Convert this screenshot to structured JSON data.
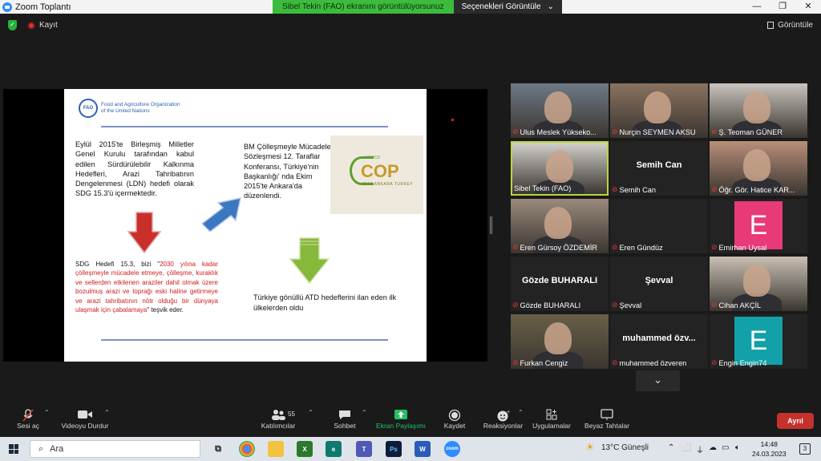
{
  "window": {
    "title": "Zoom Toplantı"
  },
  "share_bar": {
    "status": "Sibel Tekin (FAO) ekranını görüntülüyorsunuz",
    "options": "Seçenekleri Görüntüle",
    "chevron": "⌄"
  },
  "window_controls": {
    "minimize": "—",
    "maximize": "❐",
    "close": "✕"
  },
  "top_bar": {
    "recording": "Kayıt",
    "view": "Görüntüle"
  },
  "slide": {
    "org_line1": "Food and Agriculture Organization",
    "org_line2": "of the United Nations",
    "seal": "FAO",
    "block1": "Eylül 2015'te Birleşmiş Milletler Genel Kurulu tarafından kabul edilen Sürdürülebilir Kalkınma Hedefleri, Arazi Tahribatının Dengelenmesi (LDN) hedefi olarak SDG 15.3'ü içermektedir.",
    "block2": "BM Çölleşmeyle Mücadele Sözleşmesi 12. Taraflar Konferansı, Türkiye'nin Başkanlığı' nda Ekim 2015'te Ankara'da düzenlendi.",
    "cop_top": "UNCCD",
    "cop_word": "COP",
    "cop_bottom": "2015 ANKARA TURKEY",
    "block3_prefix": "SDG Hedefi 15.3, bizi \"",
    "block3_red": "2030 yılına kadar çölleşmeyle mücadele etmeye, çölleşme, kuraklık ve sellerden etkilenen araziler dahil olmak üzere bozulmuş arazi ve toprağı eski haline getirmeye ve arazi tahribatının nötr olduğu bir dünyaya ulaşmak için çabalamaya",
    "block3_suffix": "\" teşvik eder.",
    "block4": "Türkiye gönüllü ATD hedeflerini ilan eden ilk ülkelerden oldu"
  },
  "participants": [
    {
      "name": "Ulus Meslek Yükseko...",
      "big": "",
      "kind": "video",
      "color": "#6e7a86"
    },
    {
      "name": "Nurçin SEYMEN AKSU",
      "big": "",
      "kind": "video",
      "color": "#8a7360"
    },
    {
      "name": "Ş. Teoman GÜNER",
      "big": "",
      "kind": "video",
      "color": "#c9c4bd"
    },
    {
      "name": "Sibel Tekin (FAO)",
      "big": "",
      "kind": "video",
      "color": "#d3cfca"
    },
    {
      "name": "Semih Can",
      "big": "Semih Can",
      "kind": "text",
      "color": ""
    },
    {
      "name": "Öğr. Gör. Hatice KAR...",
      "big": "",
      "kind": "video",
      "color": "#b98f7a"
    },
    {
      "name": "Eren Gürsoy ÖZDEMİR",
      "big": "",
      "kind": "video",
      "color": "#9a8a7c"
    },
    {
      "name": "Eren Gündüz",
      "big": "",
      "kind": "text",
      "color": ""
    },
    {
      "name": "Emirhan Uysal",
      "big": "E",
      "kind": "avatar",
      "color": "#e83a78"
    },
    {
      "name": "Gözde BUHARALI",
      "big": "Gözde BUHARALI",
      "kind": "text",
      "color": ""
    },
    {
      "name": "Şevval",
      "big": "Şevval",
      "kind": "text",
      "color": ""
    },
    {
      "name": "Cihan AKÇİL",
      "big": "",
      "kind": "video",
      "color": "#c9c0b3"
    },
    {
      "name": "Furkan Cengiz",
      "big": "",
      "kind": "video",
      "color": "#6a6048"
    },
    {
      "name": "muhammed özveren",
      "big": "muhammed özv...",
      "kind": "text",
      "color": ""
    },
    {
      "name": "Engin Engin74",
      "big": "E",
      "kind": "avatar",
      "color": "#12a1a8"
    }
  ],
  "gallery_more": "⌄",
  "toolbar": {
    "mute": "Sesi aç",
    "video": "Videoyu Durdur",
    "participants": "Katılımcılar",
    "participants_count": "55",
    "chat": "Sohbet",
    "share": "Ekran Paylaşımı",
    "record": "Kaydet",
    "reactions": "Reaksiyonlar",
    "apps": "Uygulamalar",
    "whiteboard": "Beyaz Tahtalar",
    "leave": "Ayrıl"
  },
  "taskbar": {
    "search_placeholder": "Ara",
    "weather": "13°C  Güneşli",
    "time": "14:48",
    "date": "24.03.2023",
    "notifications": "3"
  }
}
